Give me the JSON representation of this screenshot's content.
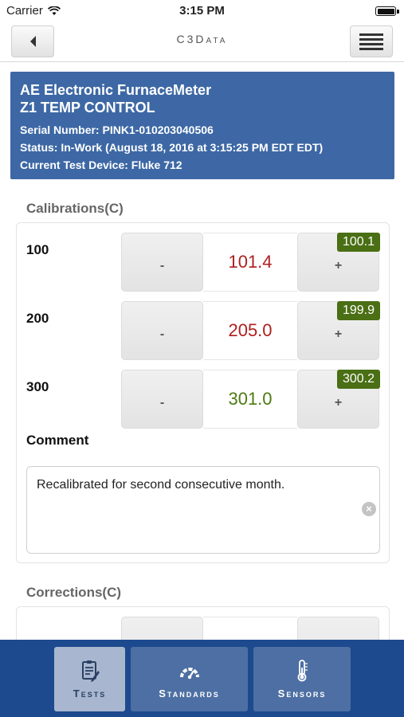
{
  "status_bar": {
    "carrier": "Carrier",
    "time": "3:15 PM"
  },
  "nav": {
    "title": "C3Data",
    "back_icon": "chevron-left-icon",
    "menu_icon": "hamburger-menu-icon"
  },
  "device": {
    "name": "AE Electronic FurnaceMeter",
    "model": "Z1 TEMP CONTROL",
    "serial": "Serial Number: PINK1-010203040506",
    "status": "Status: In-Work (August 18, 2016 at 3:15:25 PM EDT EDT)",
    "test_device": "Current Test Device: Fluke 712"
  },
  "calibrations": {
    "title": "Calibrations(C)",
    "decrement_label": "-",
    "increment_label": "+",
    "rows": [
      {
        "label": "100",
        "value": "101.4",
        "reference": "100.1",
        "value_color": "red"
      },
      {
        "label": "200",
        "value": "205.0",
        "reference": "199.9",
        "value_color": "red"
      },
      {
        "label": "300",
        "value": "301.0",
        "reference": "300.2",
        "value_color": "green"
      }
    ],
    "comment_label": "Comment",
    "comment_value": "Recalibrated for second consecutive month."
  },
  "corrections": {
    "title": "Corrections(C)"
  },
  "tabs": [
    {
      "label": "Tests",
      "icon": "clipboard-icon",
      "active": true
    },
    {
      "label": "Standards",
      "icon": "gauge-icon",
      "active": false
    },
    {
      "label": "Sensors",
      "icon": "thermometer-icon",
      "active": false
    }
  ],
  "colors": {
    "header_blue": "#3d68a5",
    "tabbar_blue": "#1d4a8e",
    "value_red": "#b01e1e",
    "value_green": "#4d7a12",
    "badge_green": "#4a6f14"
  }
}
